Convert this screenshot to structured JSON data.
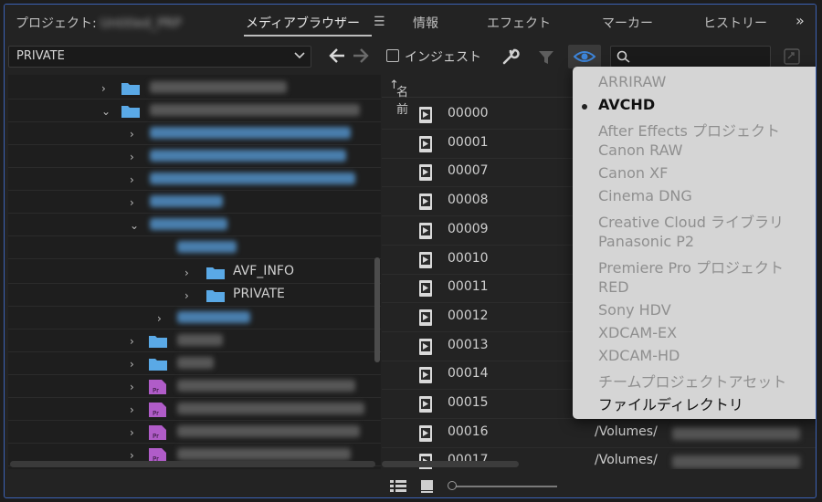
{
  "tabs": [
    {
      "label": "プロジェクト:",
      "blurred_suffix": "Untitled_PRP"
    },
    {
      "label": "メディアブラウザー"
    },
    {
      "label": "情報"
    },
    {
      "label": "エフェクト"
    },
    {
      "label": "マーカー"
    },
    {
      "label": "ヒストリー"
    }
  ],
  "toolbar": {
    "location_value": "PRIVATE",
    "ingest_label": "インジェスト",
    "search_placeholder": ""
  },
  "tree": {
    "visible_labels": [
      "AVF_INFO",
      "PRIVATE"
    ]
  },
  "list": {
    "header_name": "名前",
    "files": [
      "00000",
      "00001",
      "00007",
      "00008",
      "00009",
      "00010",
      "00011",
      "00012",
      "00013",
      "00014",
      "00015",
      "00016",
      "00017"
    ],
    "path_prefix": "/Volumes/"
  },
  "dropdown": {
    "items": [
      {
        "label": "ARRIRAW",
        "state": "disabled"
      },
      {
        "label": "AVCHD",
        "state": "checked"
      },
      {
        "label": "After Effects プロジェクト",
        "state": "disabled"
      },
      {
        "label": "Canon RAW",
        "state": "disabled"
      },
      {
        "label": "Canon XF",
        "state": "disabled"
      },
      {
        "label": "Cinema DNG",
        "state": "disabled"
      },
      {
        "label": "Creative Cloud ライブラリ",
        "state": "disabled"
      },
      {
        "label": "Panasonic P2",
        "state": "disabled"
      },
      {
        "label": "Premiere Pro プロジェクト",
        "state": "disabled"
      },
      {
        "label": "RED",
        "state": "disabled"
      },
      {
        "label": "Sony HDV",
        "state": "disabled"
      },
      {
        "label": "XDCAM-EX",
        "state": "disabled"
      },
      {
        "label": "XDCAM-HD",
        "state": "disabled"
      },
      {
        "label": "チームプロジェクトアセット",
        "state": "disabled"
      },
      {
        "label": "ファイルディレクトリ",
        "state": "enabled"
      }
    ]
  },
  "colors": {
    "accent": "#3c62b5",
    "folder": "#5aa9e6",
    "premiere": "#b05cc8",
    "eye": "#3d84d8"
  }
}
